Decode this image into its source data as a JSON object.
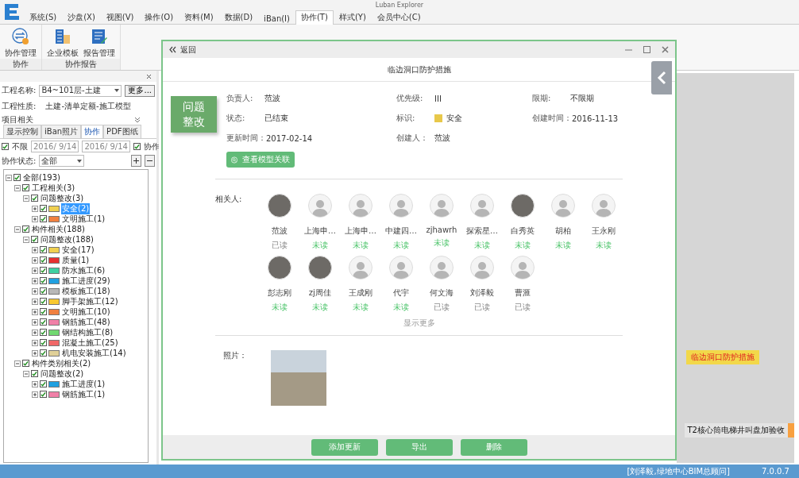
{
  "window": {
    "title": "Luban Explorer"
  },
  "menu": [
    {
      "label": "系统(S)",
      "selected": false
    },
    {
      "label": "沙盘(X)",
      "selected": false
    },
    {
      "label": "视图(V)",
      "selected": false
    },
    {
      "label": "操作(O)",
      "selected": false
    },
    {
      "label": "资料(M)",
      "selected": false
    },
    {
      "label": "数据(D)",
      "selected": false
    },
    {
      "label": "iBan(I)",
      "selected": false
    },
    {
      "label": "协作(T)",
      "selected": true
    },
    {
      "label": "样式(Y)",
      "selected": false
    },
    {
      "label": "会员中心(C)",
      "selected": false
    }
  ],
  "ribbon": [
    {
      "label": "协作",
      "buttons": [
        {
          "label": "协作管理",
          "kind": "manage"
        }
      ]
    },
    {
      "label": "协作报告",
      "buttons": [
        {
          "label": "企业模板",
          "kind": "template"
        },
        {
          "label": "报告管理",
          "kind": "report"
        }
      ]
    }
  ],
  "left_panel": {
    "project_label": "工程名称:",
    "project_name": "B4~101层-土建",
    "more_button": "更多...",
    "property_label": "工程性质:",
    "property": "土建-清单定额-施工模型",
    "section": "项目相关",
    "tabs": [
      {
        "label": "显示控制",
        "selected": false
      },
      {
        "label": "iBan照片",
        "selected": false
      },
      {
        "label": "协作",
        "selected": true
      },
      {
        "label": "PDF图纸",
        "selected": false
      }
    ],
    "unlimited": {
      "label": "不限",
      "checked": true
    },
    "date_from": "2016/ 9/14",
    "date_to": "2016/ 9/14",
    "collab": {
      "label": "协作",
      "checked": true
    },
    "status_label": "协作状态:",
    "status": "全部",
    "tree": [
      {
        "label": "全部(193)",
        "checked": true,
        "expanded": true,
        "children": [
          {
            "label": "工程相关(3)",
            "checked": true,
            "expanded": true,
            "children": [
              {
                "label": "问题整改(3)",
                "checked": true,
                "expanded": true,
                "children": [
                  {
                    "label": "安全(2)",
                    "checked": true,
                    "expanded": false,
                    "color": "#f0d050",
                    "selected": true
                  },
                  {
                    "label": "文明施工(1)",
                    "checked": true,
                    "expanded": false,
                    "color": "#f08040",
                    "selected": false
                  }
                ]
              }
            ]
          },
          {
            "label": "构件相关(188)",
            "checked": true,
            "expanded": true,
            "children": [
              {
                "label": "问题整改(188)",
                "checked": true,
                "expanded": true,
                "children": [
                  {
                    "label": "安全(17)",
                    "checked": true,
                    "expanded": false,
                    "color": "#f0d050",
                    "selected": false
                  },
                  {
                    "label": "质量(1)",
                    "checked": true,
                    "expanded": false,
                    "color": "#e83030",
                    "selected": false
                  },
                  {
                    "label": "防水施工(6)",
                    "checked": true,
                    "expanded": false,
                    "color": "#40d0a0",
                    "selected": false
                  },
                  {
                    "label": "施工进度(29)",
                    "checked": true,
                    "expanded": false,
                    "color": "#20a0e0",
                    "selected": false
                  },
                  {
                    "label": "模板施工(18)",
                    "checked": true,
                    "expanded": false,
                    "color": "#b8b8b8",
                    "selected": false
                  },
                  {
                    "label": "脚手架施工(12)",
                    "checked": true,
                    "expanded": false,
                    "color": "#f8c830",
                    "selected": false
                  },
                  {
                    "label": "文明施工(10)",
                    "checked": true,
                    "expanded": false,
                    "color": "#f08040",
                    "selected": false
                  },
                  {
                    "label": "钢筋施工(48)",
                    "checked": true,
                    "expanded": false,
                    "color": "#f080a8",
                    "selected": false
                  },
                  {
                    "label": "钢结构施工(8)",
                    "checked": true,
                    "expanded": false,
                    "color": "#70d870",
                    "selected": false
                  },
                  {
                    "label": "混凝土施工(25)",
                    "checked": true,
                    "expanded": false,
                    "color": "#f06868",
                    "selected": false
                  },
                  {
                    "label": "机电安装施工(14)",
                    "checked": true,
                    "expanded": false,
                    "color": "#e0d098",
                    "selected": false
                  }
                ]
              }
            ]
          },
          {
            "label": "构件类别相关(2)",
            "checked": true,
            "expanded": true,
            "children": [
              {
                "label": "问题整改(2)",
                "checked": true,
                "expanded": true,
                "children": [
                  {
                    "label": "施工进度(1)",
                    "checked": true,
                    "expanded": false,
                    "color": "#20a0e0",
                    "selected": false
                  },
                  {
                    "label": "钢筋施工(1)",
                    "checked": true,
                    "expanded": false,
                    "color": "#f080a8",
                    "selected": false
                  }
                ]
              }
            ]
          }
        ]
      }
    ]
  },
  "canvas": {
    "tags": [
      {
        "label": "临边洞口防护措施",
        "kind": "flag"
      },
      {
        "label": "T2核心筒电梯井叫盘加验收",
        "kind": "marker"
      }
    ]
  },
  "dialog": {
    "back": "返回",
    "title": "临边洞口防护措施",
    "badge": "问题整改",
    "fields": [
      {
        "label": "负责人:",
        "value": "范波",
        "kind": "text"
      },
      {
        "label": "优先级:",
        "value": "III",
        "kind": "text"
      },
      {
        "label": "限期:",
        "value": "不限期",
        "kind": "text"
      },
      {
        "label": "状态:",
        "value": "已结束",
        "kind": "text"
      },
      {
        "label": "标识:",
        "value": "安全",
        "kind": "tag",
        "color": "#e8c84a"
      },
      {
        "label": "创建时间：",
        "value": "2016-11-13",
        "kind": "inline"
      },
      {
        "label": "更新时间：",
        "value": "2017-02-14",
        "kind": "inline"
      },
      {
        "label": "创建人：",
        "value": "范波",
        "kind": "text"
      }
    ],
    "model_button": "查看模型关联",
    "people_label": "相关人:",
    "people": [
      {
        "name": "范波",
        "status": "已读",
        "read": true,
        "photo": true
      },
      {
        "name": "上海申…",
        "status": "未读",
        "read": false,
        "photo": false
      },
      {
        "name": "上海申…",
        "status": "未读",
        "read": false,
        "photo": false
      },
      {
        "name": "中建四…",
        "status": "未读",
        "read": false,
        "photo": false
      },
      {
        "name": "zjhawrh",
        "status": "未读",
        "read": false,
        "photo": false
      },
      {
        "name": "探索星…",
        "status": "未读",
        "read": false,
        "photo": false
      },
      {
        "name": "白秀英",
        "status": "未读",
        "read": false,
        "photo": true
      },
      {
        "name": "胡柏",
        "status": "未读",
        "read": false,
        "photo": false
      },
      {
        "name": "王永刚",
        "status": "未读",
        "read": false,
        "photo": false
      },
      {
        "name": "彭志刚",
        "status": "未读",
        "read": false,
        "photo": true
      },
      {
        "name": "zj周佳",
        "status": "未读",
        "read": false,
        "photo": true
      },
      {
        "name": "王成刚",
        "status": "未读",
        "read": false,
        "photo": false
      },
      {
        "name": "代宇",
        "status": "未读",
        "read": false,
        "photo": false
      },
      {
        "name": "何文海",
        "status": "已读",
        "read": true,
        "photo": false
      },
      {
        "name": "刘泽毅",
        "status": "已读",
        "read": true,
        "photo": false
      },
      {
        "name": "曹滙",
        "status": "已读",
        "read": true,
        "photo": false
      }
    ],
    "show_more": "显示更多",
    "photos_label": "照片：",
    "buttons": [
      "添加更新",
      "导出",
      "删除"
    ]
  },
  "status_bar": {
    "user": "[刘泽毅,绿地中心BIM总顾问]",
    "version": "7.0.0.7"
  }
}
